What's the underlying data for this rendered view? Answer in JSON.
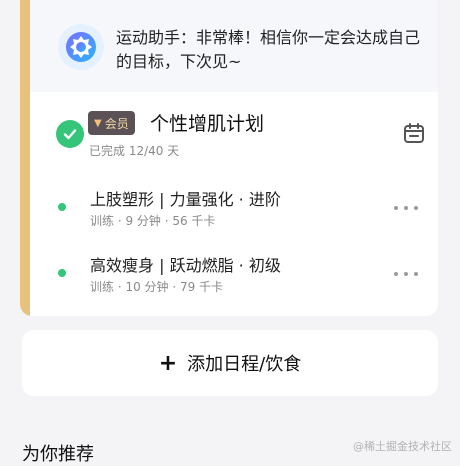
{
  "assistant": {
    "message": "运动助手：非常棒！相信你一定会达成自己的目标，下次见~"
  },
  "plan": {
    "badge": "会员",
    "title": "个性增肌计划",
    "progress": "已完成 12/40 天",
    "completed": true
  },
  "items": [
    {
      "title": "上肢塑形 | 力量强化 · 进阶",
      "meta": "训练 · 9 分钟 · 56 千卡"
    },
    {
      "title": "高效瘦身 | 跃动燃脂 · 初级",
      "meta": "训练 · 10 分钟 · 79 千卡"
    }
  ],
  "add_button": {
    "label": "添加日程/饮食"
  },
  "recommend": {
    "title": "为你推荐"
  },
  "watermark": "@稀土掘金技术社区",
  "colors": {
    "accent": "#e8c27a",
    "success": "#34c47a",
    "badge_bg": "#5b5257",
    "badge_text": "#f2d7a6"
  }
}
